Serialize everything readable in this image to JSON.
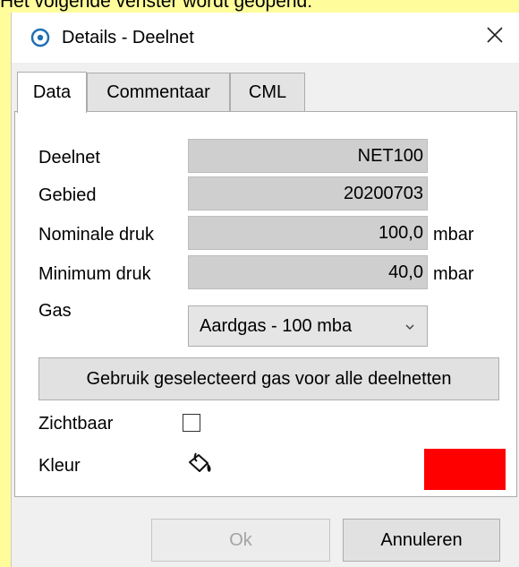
{
  "caption": "Het volgende venster wordt geopend:",
  "window": {
    "title": "Details - Deelnet",
    "app_icon": "target-icon",
    "close_icon": "close-icon"
  },
  "tabs": [
    {
      "label": "Data",
      "active": true
    },
    {
      "label": "Commentaar",
      "active": false
    },
    {
      "label": "CML",
      "active": false
    }
  ],
  "form": {
    "deelnet": {
      "label": "Deelnet",
      "value": "NET100"
    },
    "gebied": {
      "label": "Gebied",
      "value": "20200703"
    },
    "nominale_druk": {
      "label": "Nominale druk",
      "value": "100,0",
      "unit": "mbar"
    },
    "minimum_druk": {
      "label": "Minimum druk",
      "value": "40,0",
      "unit": "mbar"
    },
    "gas": {
      "label": "Gas",
      "selected": "Aardgas - 100 mba"
    },
    "apply_gas_button": "Gebruik geselecteerd gas voor alle deelnetten",
    "zichtbaar": {
      "label": "Zichtbaar",
      "checked": false
    },
    "kleur": {
      "label": "Kleur",
      "color": "#ff0000",
      "icon": "paint-bucket-icon"
    }
  },
  "footer": {
    "ok_label": "Ok",
    "cancel_label": "Annuleren"
  }
}
